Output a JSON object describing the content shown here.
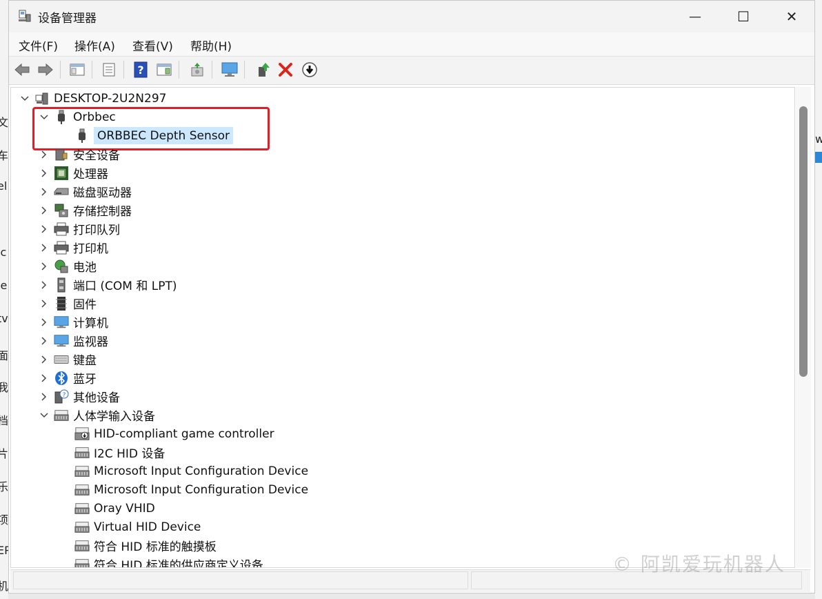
{
  "background": {
    "left_fragments": [
      "文",
      "车",
      "el",
      "ic",
      "je",
      "tv",
      "面",
      "我",
      "档",
      "片",
      "乐",
      "项",
      "EP",
      "机"
    ],
    "right_fragment": "w"
  },
  "window": {
    "title": "设备管理器",
    "controls": {
      "minimize": "—",
      "maximize": "☐",
      "close": "✕"
    }
  },
  "menu": [
    "文件(F)",
    "操作(A)",
    "查看(V)",
    "帮助(H)"
  ],
  "tree": {
    "root": "DESKTOP-2U2N297",
    "nodes": [
      {
        "label": "Orbbec",
        "expanded": true,
        "icon": "usb-plug-icon",
        "children": [
          {
            "label": "ORBBEC Depth Sensor",
            "selected": true,
            "icon": "usb-plug-icon"
          }
        ]
      },
      {
        "label": "安全设备",
        "icon": "security-device-icon"
      },
      {
        "label": "处理器",
        "icon": "processor-icon"
      },
      {
        "label": "磁盘驱动器",
        "icon": "disk-drive-icon"
      },
      {
        "label": "存储控制器",
        "icon": "storage-controller-icon"
      },
      {
        "label": "打印队列",
        "icon": "print-queue-icon"
      },
      {
        "label": "打印机",
        "icon": "printer-icon"
      },
      {
        "label": "电池",
        "icon": "battery-icon"
      },
      {
        "label": "端口 (COM 和 LPT)",
        "icon": "port-icon"
      },
      {
        "label": "固件",
        "icon": "firmware-icon"
      },
      {
        "label": "计算机",
        "icon": "computer-icon"
      },
      {
        "label": "监视器",
        "icon": "monitor-icon"
      },
      {
        "label": "键盘",
        "icon": "keyboard-icon"
      },
      {
        "label": "蓝牙",
        "icon": "bluetooth-icon"
      },
      {
        "label": "其他设备",
        "icon": "unknown-device-icon"
      },
      {
        "label": "人体学输入设备",
        "expanded": true,
        "icon": "hid-icon",
        "children": [
          {
            "label": "HID-compliant game controller",
            "icon": "hid-game-controller-icon"
          },
          {
            "label": "I2C HID 设备",
            "icon": "hid-icon"
          },
          {
            "label": "Microsoft Input Configuration Device",
            "icon": "hid-icon"
          },
          {
            "label": "Microsoft Input Configuration Device",
            "icon": "hid-icon"
          },
          {
            "label": "Oray VHID",
            "icon": "hid-icon"
          },
          {
            "label": "Virtual HID Device",
            "icon": "hid-icon"
          },
          {
            "label": "符合 HID 标准的触摸板",
            "icon": "hid-icon"
          },
          {
            "label": "符合 HID 标准的供应商定义设备",
            "icon": "hid-icon"
          }
        ]
      }
    ]
  },
  "watermark": "© 阿凯爱玩机器人",
  "colors": {
    "selection": "#cce8ff",
    "highlight_box": "#e51c23",
    "uninstall_x": "#d9261c"
  }
}
